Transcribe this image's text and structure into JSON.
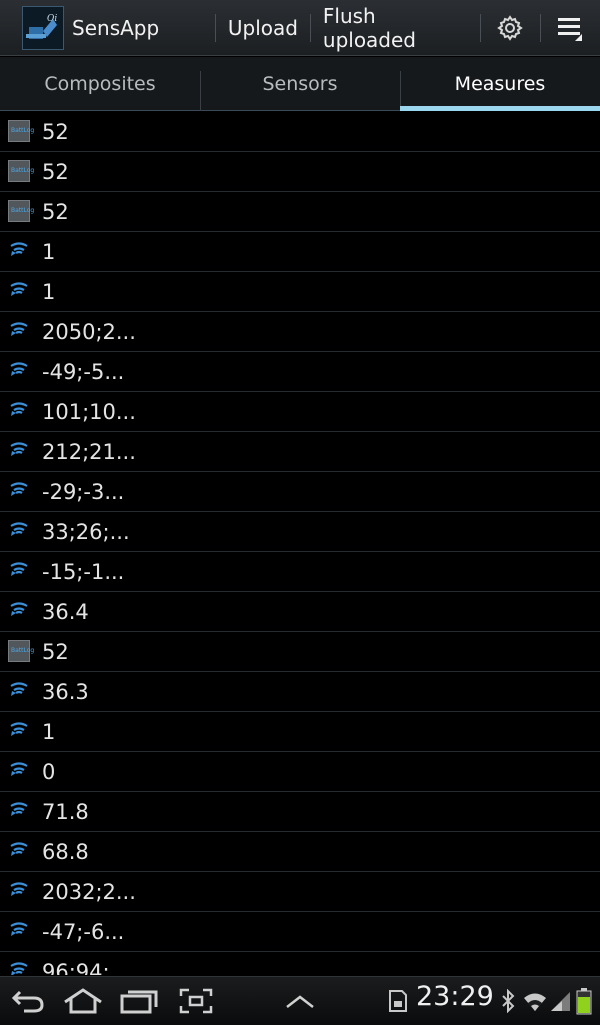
{
  "app": {
    "title": "SensApp",
    "icon": "sensapp-logo"
  },
  "actionbar": {
    "upload_label": "Upload",
    "flush_label": "Flush uploaded",
    "settings_icon": "gear-icon",
    "overflow_icon": "menu-icon"
  },
  "tabs": [
    {
      "label": "Composites",
      "active": false
    },
    {
      "label": "Sensors",
      "active": false
    },
    {
      "label": "Measures",
      "active": true
    }
  ],
  "measures": [
    {
      "icon": "battery-sensor-icon",
      "value": "52"
    },
    {
      "icon": "battery-sensor-icon",
      "value": "52"
    },
    {
      "icon": "battery-sensor-icon",
      "value": "52"
    },
    {
      "icon": "wireless-sensor-icon",
      "value": "1"
    },
    {
      "icon": "wireless-sensor-icon",
      "value": "1"
    },
    {
      "icon": "wireless-sensor-icon",
      "value": "2050;2..."
    },
    {
      "icon": "wireless-sensor-icon",
      "value": "-49;-5..."
    },
    {
      "icon": "wireless-sensor-icon",
      "value": "101;10..."
    },
    {
      "icon": "wireless-sensor-icon",
      "value": "212;21..."
    },
    {
      "icon": "wireless-sensor-icon",
      "value": "-29;-3..."
    },
    {
      "icon": "wireless-sensor-icon",
      "value": "33;26;..."
    },
    {
      "icon": "wireless-sensor-icon",
      "value": "-15;-1..."
    },
    {
      "icon": "wireless-sensor-icon",
      "value": "36.4"
    },
    {
      "icon": "battery-sensor-icon",
      "value": "52"
    },
    {
      "icon": "wireless-sensor-icon",
      "value": "36.3"
    },
    {
      "icon": "wireless-sensor-icon",
      "value": "1"
    },
    {
      "icon": "wireless-sensor-icon",
      "value": "0"
    },
    {
      "icon": "wireless-sensor-icon",
      "value": "71.8"
    },
    {
      "icon": "wireless-sensor-icon",
      "value": "68.8"
    },
    {
      "icon": "wireless-sensor-icon",
      "value": "2032;2..."
    },
    {
      "icon": "wireless-sensor-icon",
      "value": "-47;-6..."
    },
    {
      "icon": "wireless-sensor-icon",
      "value": "96;94;..."
    }
  ],
  "battery_icon_label": "BattLog",
  "statusbar": {
    "time": "23:29"
  },
  "colors": {
    "accent": "#9bd6ef",
    "sensor_icon": "#3a8fd8",
    "background": "#000000"
  }
}
